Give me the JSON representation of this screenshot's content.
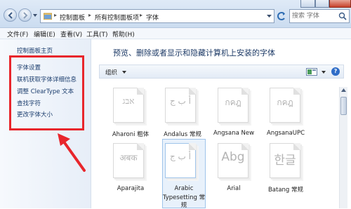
{
  "address_bar": {
    "breadcrumbs": [
      "控制面板",
      "所有控制面板项",
      "字体"
    ],
    "search_placeholder": "搜索 字体"
  },
  "menubar": {
    "items": [
      "文件(F)",
      "编辑(E)",
      "查看(V)",
      "工具(T)",
      "帮助(H)"
    ]
  },
  "left_pane": {
    "home_link": "控制面板主页",
    "links": [
      "字体设置",
      "联机获取字体详细信息",
      "调整 ClearType 文本",
      "查找字符",
      "更改字体大小"
    ]
  },
  "content": {
    "heading": "预览、删除或者显示和隐藏计算机上安装的字体",
    "organize_label": "组织",
    "help_glyph": "?"
  },
  "fonts": [
    {
      "name": "Aharoni 粗体",
      "sample": "אבג"
    },
    {
      "name": "Andalus 常规",
      "sample": "أ ب ج"
    },
    {
      "name": "Angsana New",
      "sample": "กคฎ"
    },
    {
      "name": "AngsanaUPC",
      "sample": "กคฎ"
    },
    {
      "name": "Aparajita",
      "sample": "अबक"
    },
    {
      "name_lines": [
        "Arabic",
        "Typesetting 常",
        "规"
      ],
      "sample": "أ ب ج"
    },
    {
      "name": "Arial",
      "sample": "Abg"
    },
    {
      "name": "Batang 常规",
      "sample": "한글"
    }
  ],
  "annotation": {
    "highlight_color": "#e8262c"
  }
}
